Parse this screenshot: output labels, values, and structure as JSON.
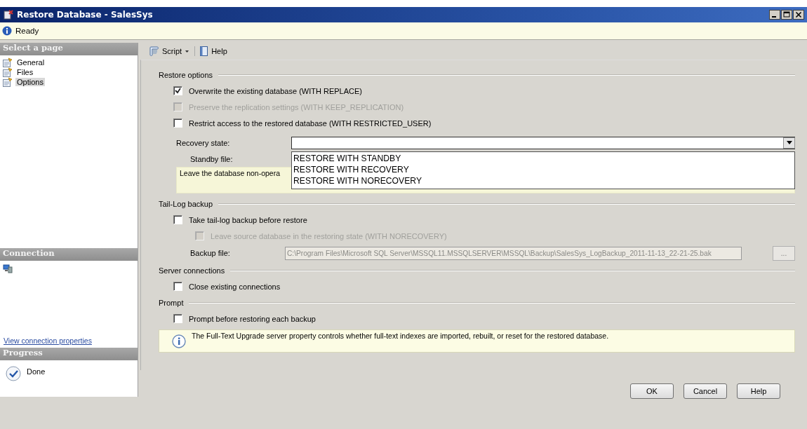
{
  "window": {
    "title": "Restore Database - SalesSys"
  },
  "status": {
    "text": "Ready"
  },
  "sidebar": {
    "header": "Select a page",
    "pages": [
      {
        "label": "General",
        "selected": false
      },
      {
        "label": "Files",
        "selected": false
      },
      {
        "label": "Options",
        "selected": true
      }
    ],
    "connection": {
      "header": "Connection",
      "link": "View connection properties"
    },
    "progress": {
      "header": "Progress",
      "status": "Done"
    }
  },
  "toolbar": [
    {
      "label": "Script",
      "kind": "dropdown"
    },
    {
      "label": "Help",
      "kind": "plain"
    }
  ],
  "sections": [
    {
      "title": "Restore options",
      "items": [
        {
          "kind": "checkbox",
          "label": "Overwrite the existing database (WITH REPLACE)",
          "checked": true,
          "disabled": false
        },
        {
          "kind": "checkbox",
          "label": "Preserve the replication settings (WITH KEEP_REPLICATION)",
          "checked": false,
          "disabled": true
        },
        {
          "kind": "checkbox",
          "label": "Restrict access to the restored database (WITH RESTRICTED_USER)",
          "checked": false,
          "disabled": false
        },
        {
          "kind": "combo",
          "label": "Recovery state:",
          "expanded": true,
          "options": [
            "RESTORE WITH STANDBY",
            "RESTORE WITH RECOVERY",
            "RESTORE WITH NORECOVERY"
          ]
        },
        {
          "kind": "field-label",
          "label": "Standby file:"
        },
        {
          "kind": "note",
          "text": "Leave the database non-opera"
        }
      ]
    },
    {
      "title": "Tail-Log backup",
      "items": [
        {
          "kind": "checkbox",
          "label": "Take tail-log backup before restore",
          "checked": false,
          "disabled": false,
          "children": [
            {
              "kind": "checkbox",
              "label": "Leave source database in the restoring state (WITH NORECOVERY)",
              "checked": false,
              "disabled": true
            }
          ]
        },
        {
          "kind": "file",
          "label": "Backup file:",
          "value": "C:\\Program Files\\Microsoft SQL Server\\MSSQL11.MSSQLSERVER\\MSSQL\\Backup\\SalesSys_LogBackup_2011-11-13_22-21-25.bak",
          "disabled": true,
          "button": "..."
        }
      ]
    },
    {
      "title": "Server connections",
      "items": [
        {
          "kind": "checkbox",
          "label": "Close existing connections",
          "checked": false,
          "disabled": false
        }
      ]
    },
    {
      "title": "Prompt",
      "items": [
        {
          "kind": "checkbox",
          "label": "Prompt before restoring each backup",
          "checked": false,
          "disabled": false
        }
      ]
    }
  ],
  "info": "The Full-Text Upgrade server property controls whether full-text indexes are imported, rebuilt, or reset for the restored database.",
  "buttons": [
    "OK",
    "Cancel",
    "Help"
  ]
}
